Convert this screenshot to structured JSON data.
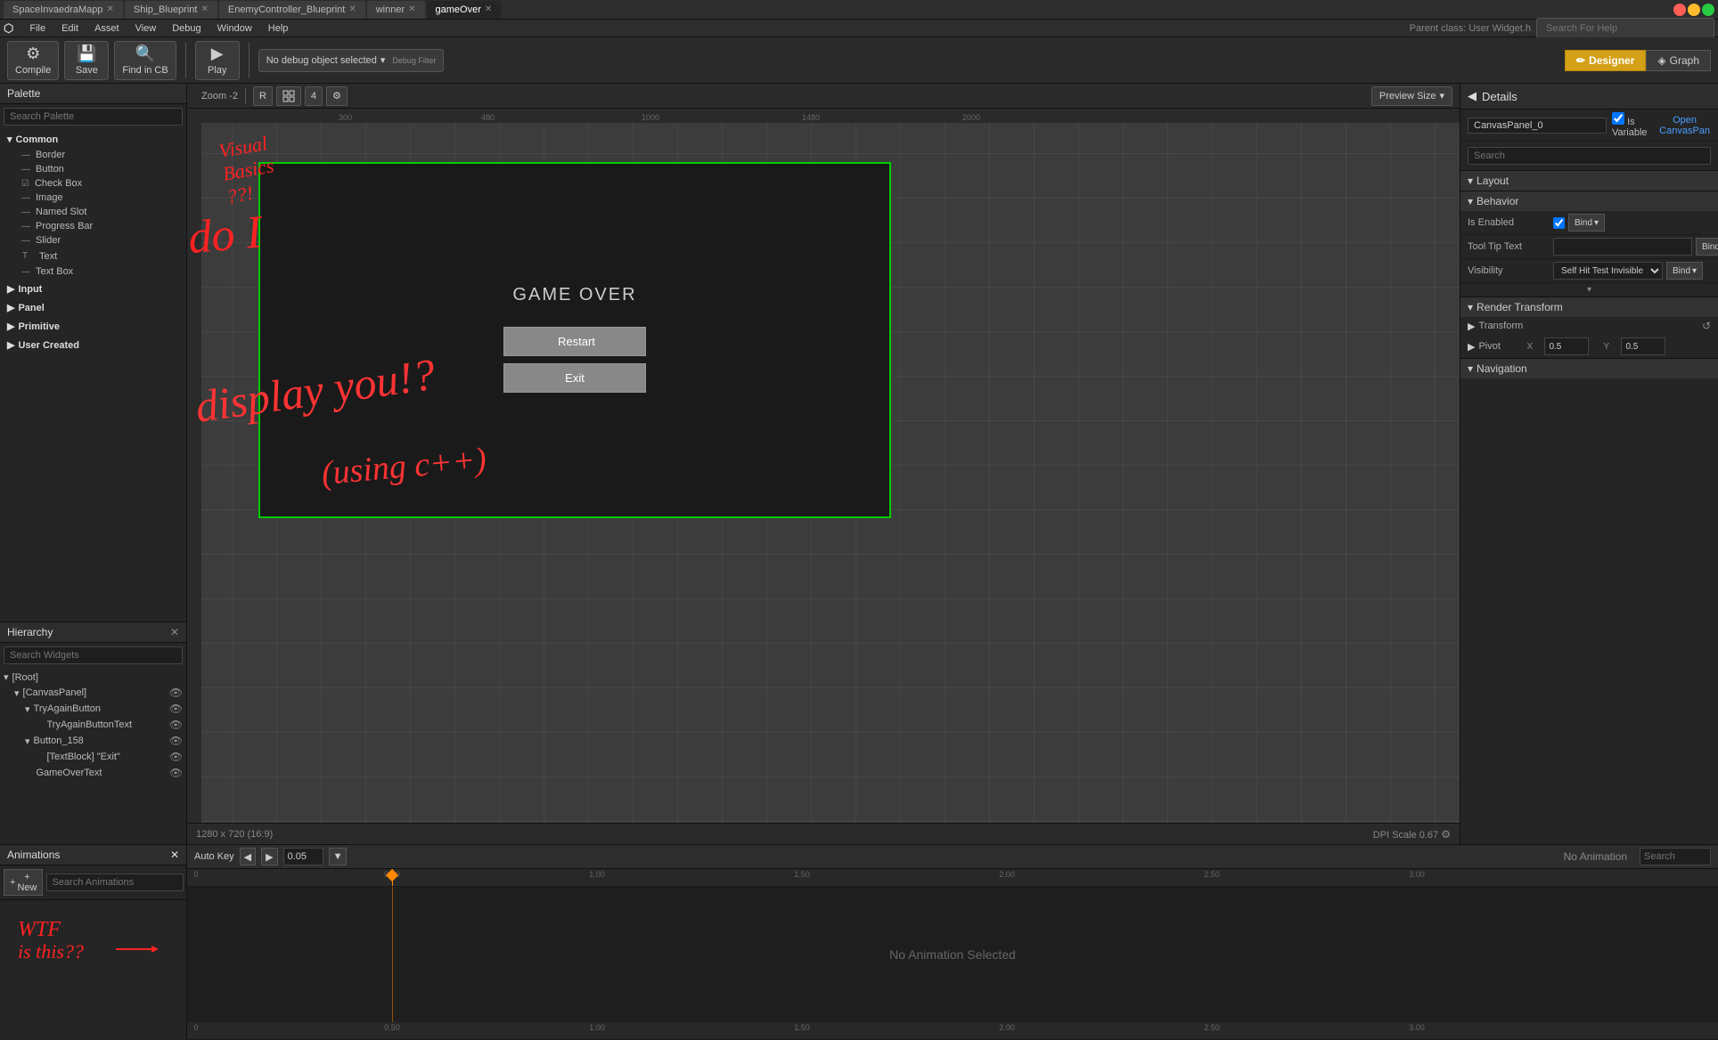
{
  "titlebar": {
    "tabs": [
      {
        "label": "SpaceInvaedraMapp",
        "active": false
      },
      {
        "label": "Ship_Blueprint",
        "active": false
      },
      {
        "label": "EnemyController_Blueprint",
        "active": false
      },
      {
        "label": "winner",
        "active": false
      },
      {
        "label": "gameOver",
        "active": true
      }
    ],
    "winButtons": [
      "minimize",
      "maximize",
      "close"
    ]
  },
  "menubar": {
    "items": [
      "File",
      "Edit",
      "Asset",
      "View",
      "Debug",
      "Window",
      "Help"
    ]
  },
  "toolbar": {
    "compile_label": "Compile",
    "save_label": "Save",
    "find_in_cb_label": "Find in CB",
    "play_label": "Play",
    "debug_filter_label": "No debug object selected",
    "debug_filter_placeholder": "Debug Filter",
    "search_for_help_placeholder": "Search For Help",
    "designer_label": "Designer",
    "graph_label": "Graph"
  },
  "palette": {
    "title": "Palette",
    "search_placeholder": "Search Palette",
    "groups": [
      {
        "name": "Common",
        "expanded": true,
        "items": [
          {
            "label": "Border",
            "checked": false
          },
          {
            "label": "Button",
            "checked": false
          },
          {
            "label": "Check Box",
            "checked": true
          },
          {
            "label": "Image",
            "checked": false
          },
          {
            "label": "Named Slot",
            "checked": false
          },
          {
            "label": "Progress Bar",
            "checked": false
          },
          {
            "label": "Slider",
            "checked": false
          },
          {
            "label": "Text",
            "checked": false
          },
          {
            "label": "Text Box",
            "checked": false
          }
        ]
      },
      {
        "name": "Input",
        "expanded": false,
        "items": []
      },
      {
        "name": "Panel",
        "expanded": false,
        "items": []
      },
      {
        "name": "Primitive",
        "expanded": false,
        "items": []
      },
      {
        "name": "User Created",
        "expanded": false,
        "items": []
      }
    ]
  },
  "hierarchy": {
    "title": "Hierarchy",
    "search_placeholder": "Search Widgets",
    "tree": [
      {
        "label": "[Root]",
        "indent": 0,
        "expanded": true,
        "has_eye": false
      },
      {
        "label": "[CanvasPanel]",
        "indent": 1,
        "expanded": true,
        "has_eye": true
      },
      {
        "label": "TryAgainButton",
        "indent": 2,
        "expanded": true,
        "has_eye": true
      },
      {
        "label": "TryAgainButtonText",
        "indent": 3,
        "expanded": false,
        "has_eye": true
      },
      {
        "label": "Button_158",
        "indent": 2,
        "expanded": true,
        "has_eye": true
      },
      {
        "label": "[TextBlock] \"Exit\"",
        "indent": 3,
        "expanded": false,
        "has_eye": true
      },
      {
        "label": "GameOverText",
        "indent": 2,
        "expanded": false,
        "has_eye": true
      }
    ]
  },
  "canvas": {
    "zoom_label": "Zoom -2",
    "btns": [
      "R",
      "grid",
      "4",
      "settings"
    ],
    "preview_size_label": "Preview Size",
    "resolution": "1280 x 720 (16:9)",
    "dpi_scale": "DPI Scale 0.67",
    "game_over_text": "GAME OVER",
    "restart_btn_label": "Restart",
    "exit_btn_label": "Exit"
  },
  "details": {
    "title": "Details",
    "canvas_panel_name": "CanvasPanel_0",
    "is_variable_label": "Is Variable",
    "open_canvas_pan_label": "Open CanvasPan",
    "search_placeholder": "Search",
    "sections": {
      "layout": "Layout",
      "behavior": "Behavior",
      "render_transform": "Render Transform",
      "navigation": "Navigation"
    },
    "behavior": {
      "is_enabled_label": "Is Enabled",
      "tool_tip_text_label": "Tool Tip Text",
      "visibility_label": "Visibility",
      "visibility_value": "Self Hit Test Invisible",
      "bind_label": "Bind"
    },
    "render_transform": {
      "transform_label": "Transform",
      "pivot_label": "Pivot",
      "pivot_x": "0.5",
      "pivot_y": "0.5"
    }
  },
  "animations": {
    "title": "Animations",
    "new_btn_label": "+ New",
    "search_placeholder": "Search Animations",
    "no_animation_selected": "No Animation Selected"
  },
  "timeline": {
    "auto_key_label": "Auto Key",
    "time_value": "0.05",
    "no_animation_label": "No Animation",
    "search_placeholder": "Search",
    "ruler_marks": [
      "0",
      "0.50",
      "1.00",
      "1.50",
      "2.00",
      "2.50",
      "3.00"
    ],
    "ruler_marks_bottom": [
      "0",
      "0.50",
      "1.00",
      "1.50",
      "2.00",
      "2.50",
      "3.00"
    ]
  }
}
